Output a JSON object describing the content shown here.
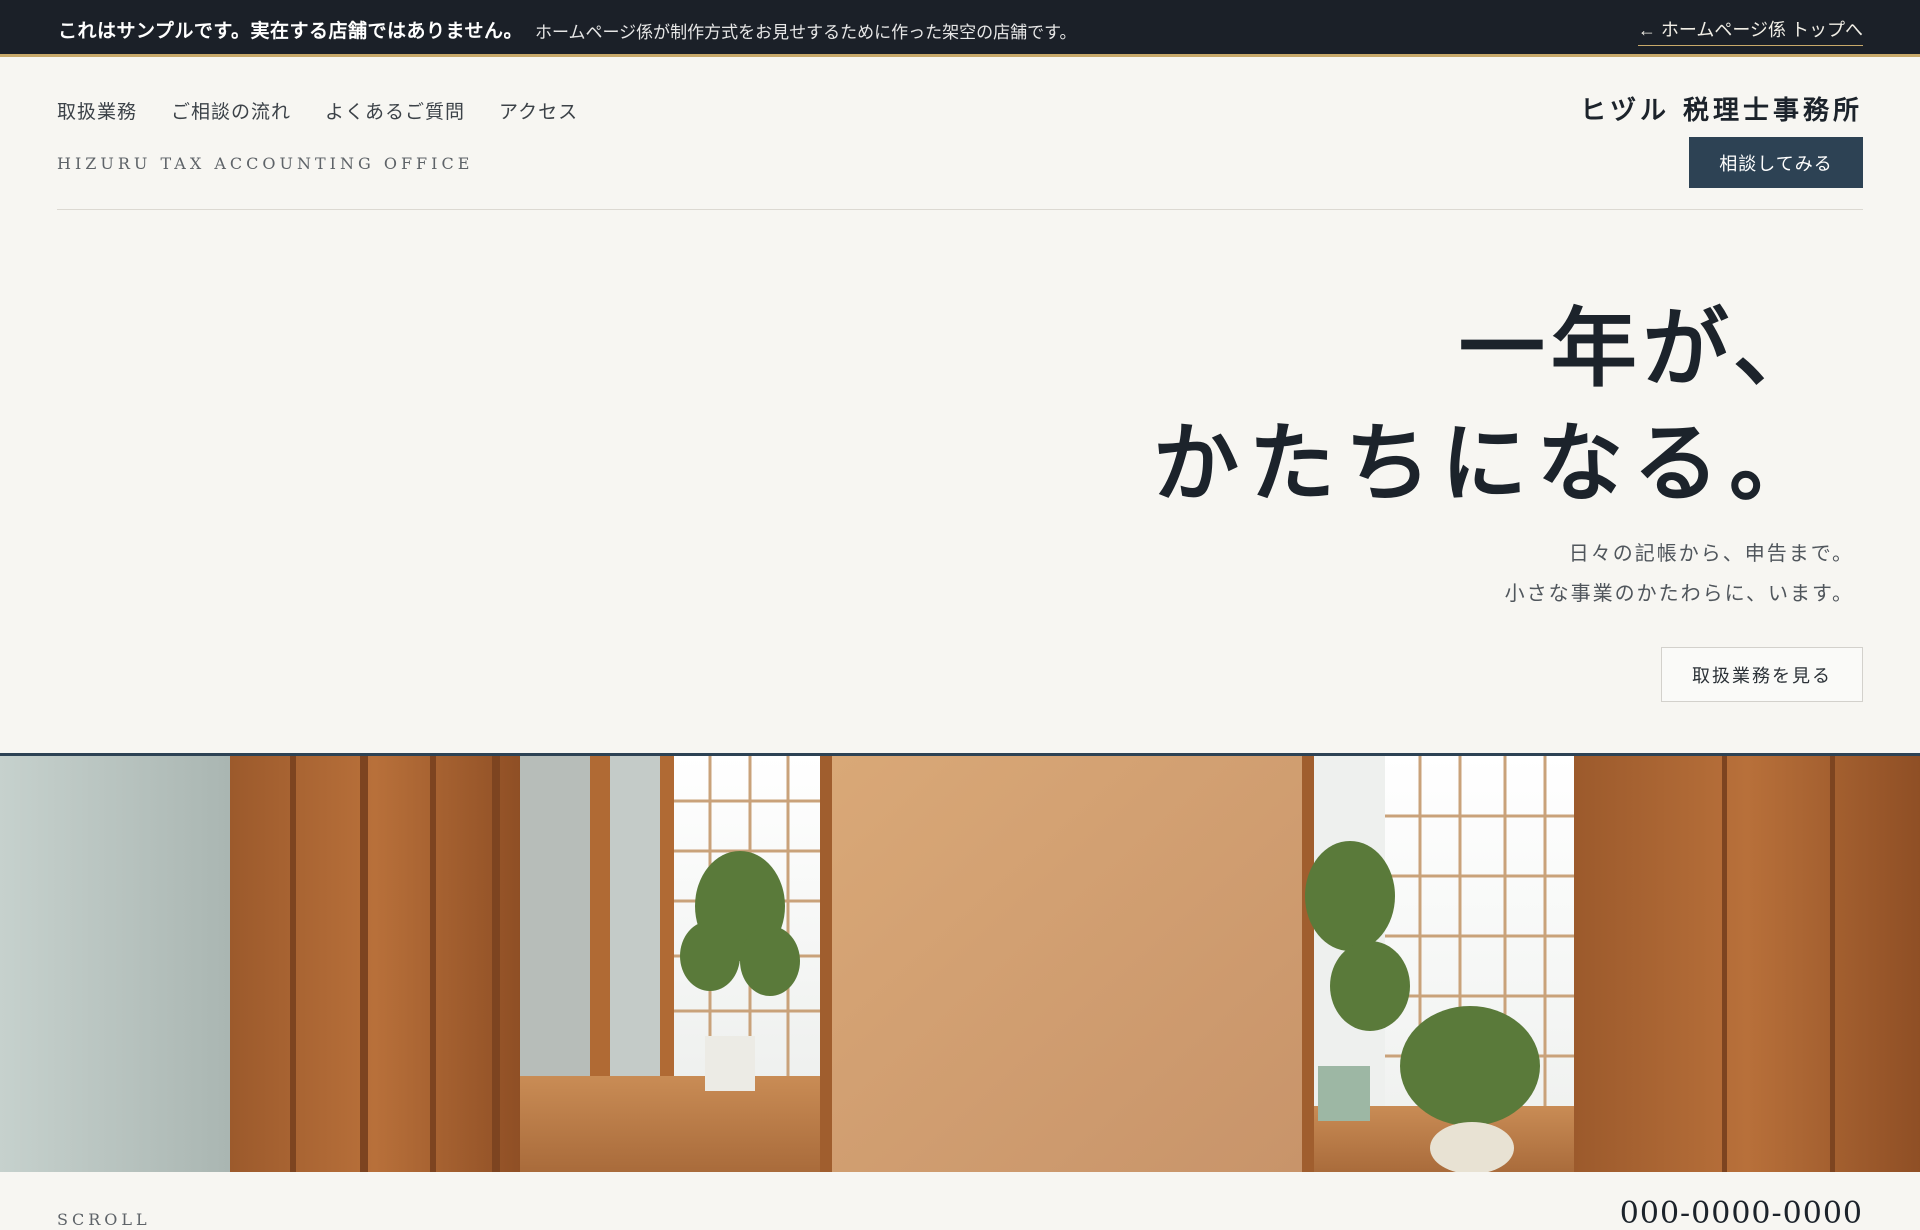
{
  "topbar": {
    "bold_text": "これはサンプルです。実在する店舗ではありません。",
    "note_text": "ホームページ係が制作方式をお見せするために作った架空の店舗です。",
    "back_link": "← ホームページ係 トップへ"
  },
  "nav": {
    "items": [
      "取扱業務",
      "ご相談の流れ",
      "よくあるご質問",
      "アクセス"
    ]
  },
  "brand": {
    "en_name": "HIZURU TAX ACCOUNTING OFFICE",
    "jp_name": "ヒヅル 税理士事務所",
    "cta_label": "相談してみる"
  },
  "hero": {
    "line1": "一年が、",
    "line2": "かたちになる。",
    "sub1": "日々の記帳から、申告まで。",
    "sub2": "小さな事業のかたわらに、います。",
    "button_label": "取扱業務を見る"
  },
  "footer": {
    "scroll_label": "SCROLL",
    "phone": "000-0000-0000"
  },
  "colors": {
    "topbar_bg": "#1b2028",
    "accent_gold": "#c8a96a",
    "cta_bg": "#2d4254",
    "page_bg": "#f7f6f2"
  }
}
